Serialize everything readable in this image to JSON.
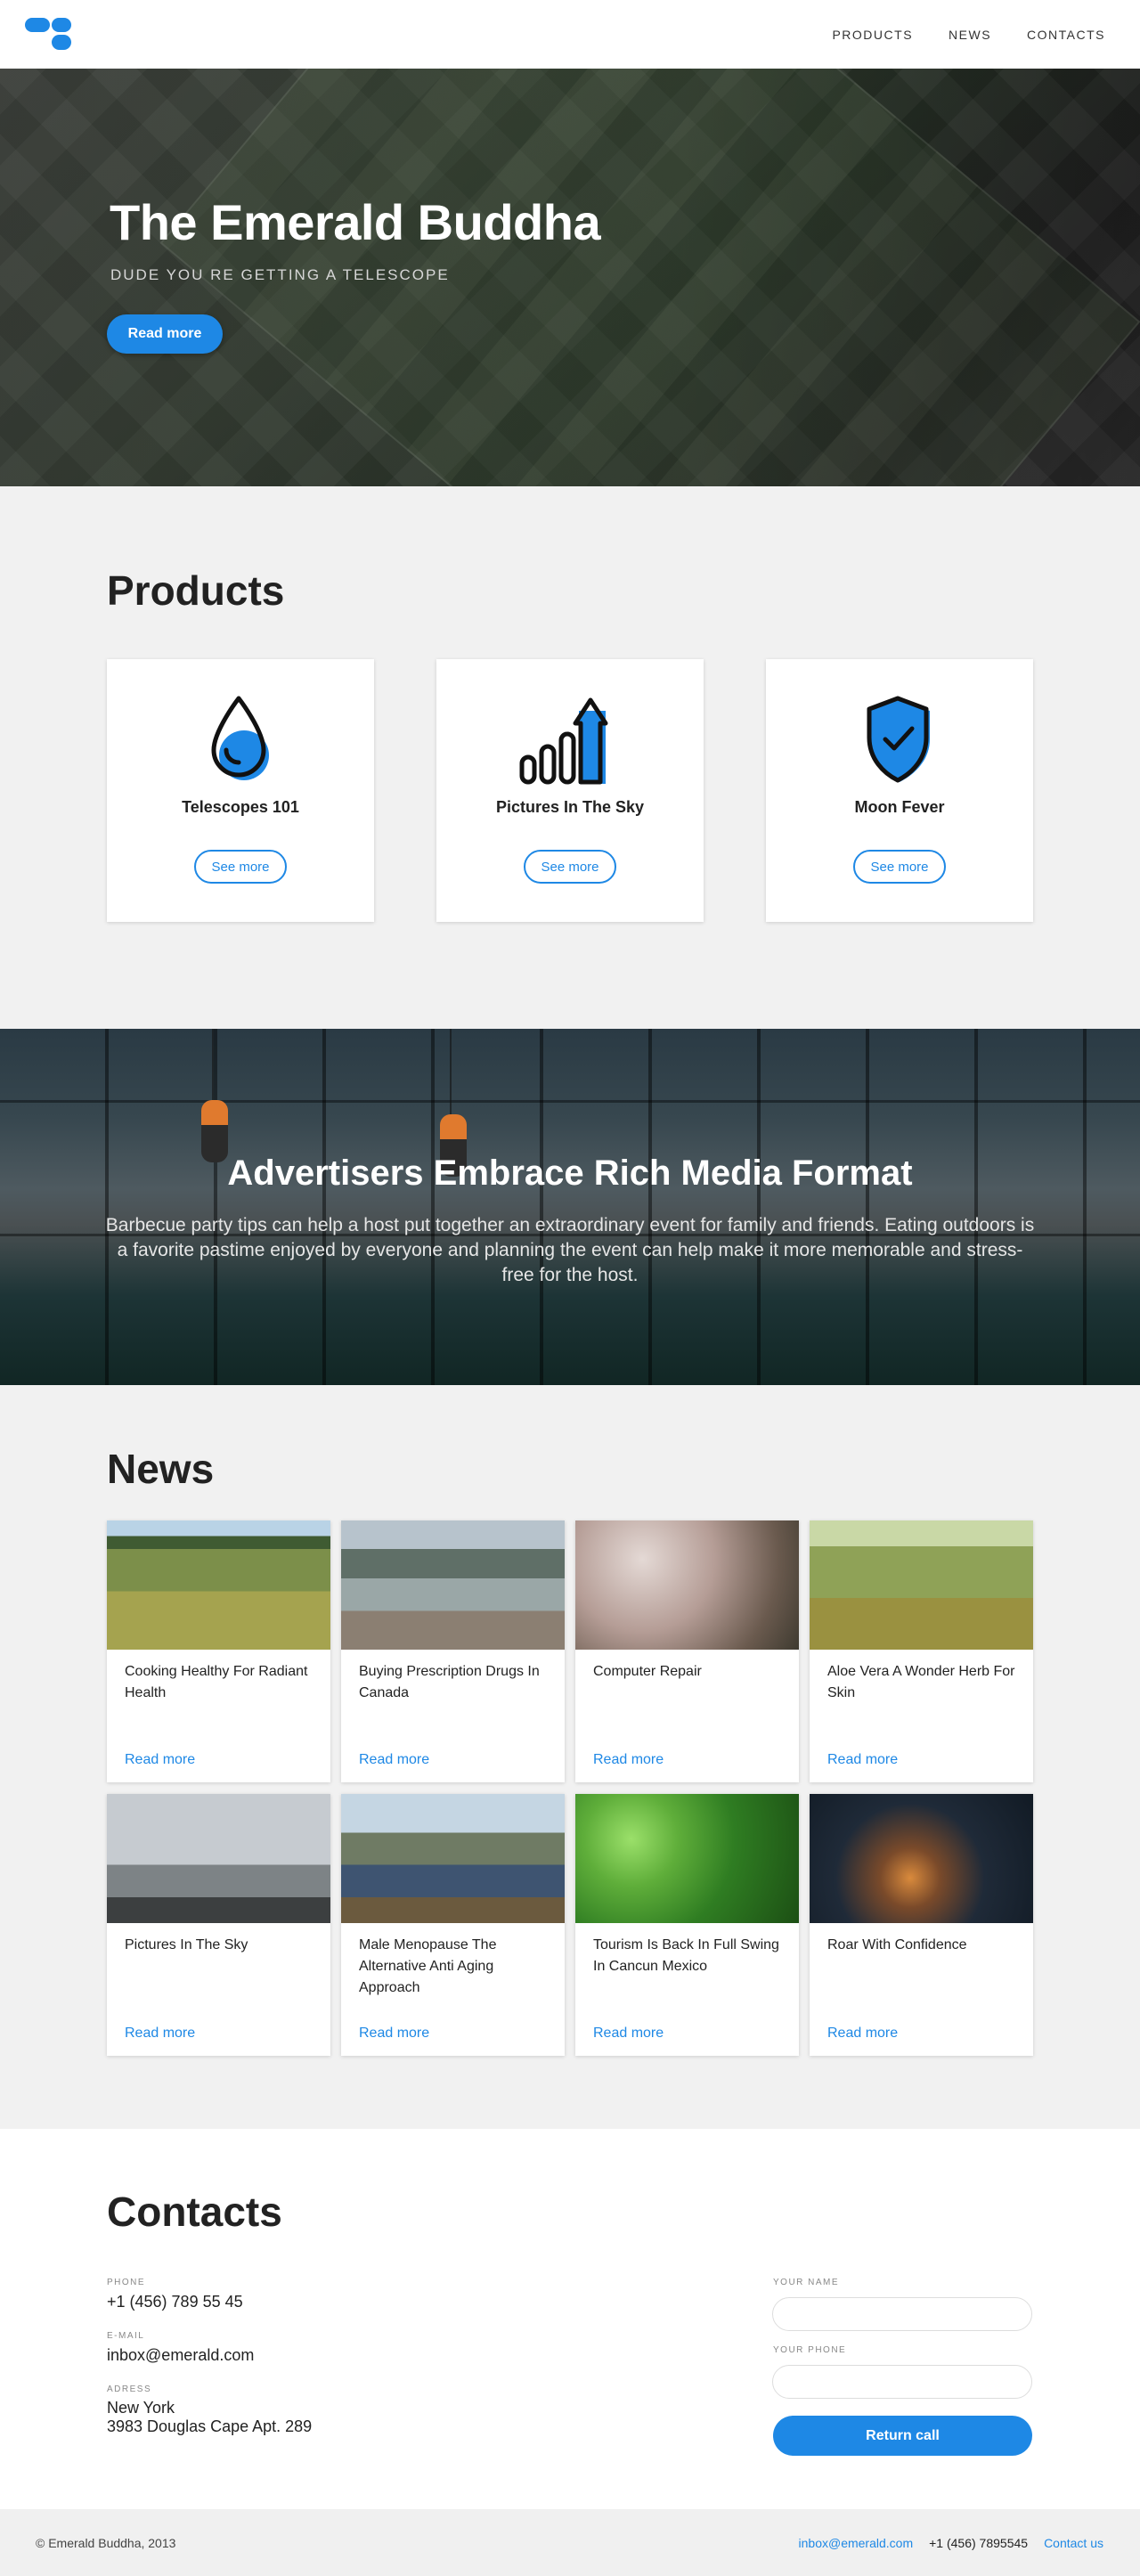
{
  "header": {
    "nav": [
      "PRODUCTS",
      "NEWS",
      "CONTACTS"
    ]
  },
  "hero": {
    "title": "The Emerald Buddha",
    "subtitle": "DUDE YOU RE GETTING A TELESCOPE",
    "button": "Read more"
  },
  "products": {
    "title": "Products",
    "items": [
      {
        "name": "Telescopes 101",
        "icon": "water-drop-icon",
        "button": "See more"
      },
      {
        "name": "Pictures In The Sky",
        "icon": "growth-chart-icon",
        "button": "See more"
      },
      {
        "name": "Moon Fever",
        "icon": "shield-check-icon",
        "button": "See more"
      }
    ]
  },
  "banner": {
    "title": "Advertisers Embrace Rich Media Format",
    "text": "Barbecue party tips can help a host put together an extraordinary event for family and friends. Eating outdoors is a favorite pastime enjoyed by everyone and planning the event can help make it more memorable and stress-free for the host."
  },
  "news": {
    "title": "News",
    "read_more": "Read more",
    "items": [
      {
        "title": "Cooking Healthy For Radiant Health"
      },
      {
        "title": "Buying Prescription Drugs In Canada"
      },
      {
        "title": "Computer Repair"
      },
      {
        "title": "Aloe Vera A Wonder Herb For Skin"
      },
      {
        "title": "Pictures In The Sky"
      },
      {
        "title": "Male Menopause The Alternative Anti Aging Approach"
      },
      {
        "title": "Tourism Is Back In Full Swing In Cancun Mexico"
      },
      {
        "title": "Roar With Confidence"
      }
    ]
  },
  "contacts": {
    "title": "Contacts",
    "phone_label": "PHONE",
    "phone": "+1 (456) 789 55 45",
    "email_label": "E-MAIL",
    "email": "inbox@emerald.com",
    "address_label": "ADRESS",
    "address_city": "New York",
    "address_street": "3983 Douglas Cape Apt. 289",
    "name_label": "YOUR NAME",
    "phone_field_label": "YOUR PHONE",
    "button": "Return call"
  },
  "footer": {
    "copyright": "© Emerald Buddha, 2013",
    "email": "inbox@emerald.com",
    "phone": "+1 (456) 7895545",
    "contact_link": "Contact us"
  },
  "colors": {
    "accent": "#1e88e5",
    "background": "#f1f1f1"
  }
}
